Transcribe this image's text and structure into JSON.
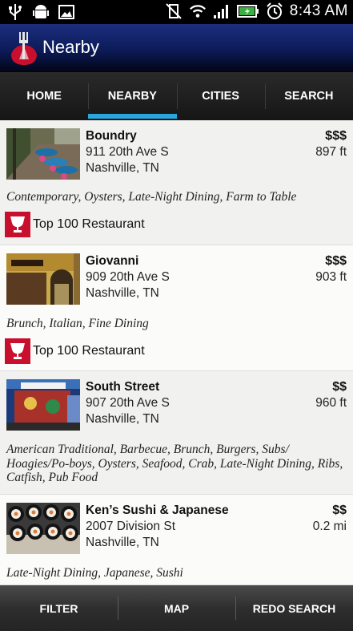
{
  "status_bar": {
    "left_icons": [
      "usb-icon",
      "android-debug-icon",
      "image-notification-icon"
    ],
    "right_icons": [
      "vibrate-mute-icon",
      "wifi-icon",
      "signal-icon",
      "battery-icon",
      "alarm-icon"
    ],
    "time": "8:43 AM"
  },
  "action_bar": {
    "title": "Nearby",
    "logo_icon": "fork-logo-icon"
  },
  "tabs": [
    {
      "label": "HOME",
      "active": false
    },
    {
      "label": "NEARBY",
      "active": true
    },
    {
      "label": "CITIES",
      "active": false
    },
    {
      "label": "SEARCH",
      "active": false
    }
  ],
  "restaurants": [
    {
      "name": "Boundry",
      "address": "911 20th Ave S",
      "city": "Nashville, TN",
      "price": "$$$",
      "distance": "897 ft",
      "tags": "Contemporary, Oysters, Late-Night Dining, Farm to Table",
      "award": "Top 100 Restaurant",
      "thumb": "patio-photo"
    },
    {
      "name": "Giovanni",
      "address": "909 20th Ave S",
      "city": "Nashville, TN",
      "price": "$$$",
      "distance": "903 ft",
      "tags": "Brunch, Italian, Fine Dining",
      "award": "Top 100 Restaurant",
      "thumb": "storefront-photo"
    },
    {
      "name": "South Street",
      "address": "907 20th Ave S",
      "city": "Nashville, TN",
      "price": "$$",
      "distance": "960 ft",
      "tags": "American Traditional, Barbecue, Brunch, Burgers, Subs/ Hoagies/Po-boys, Oysters, Seafood, Crab, Late-Night Dining, Ribs, Catfish, Pub Food",
      "award": null,
      "thumb": "mural-photo"
    },
    {
      "name": "Ken’s Sushi & Japanese",
      "address": "2007 Division St",
      "city": "Nashville, TN",
      "price": "$$",
      "distance": "0.2 mi",
      "tags": "Late-Night Dining, Japanese, Sushi",
      "award": null,
      "thumb": "sushi-photo"
    }
  ],
  "bottom_bar": [
    {
      "label": "FILTER"
    },
    {
      "label": "MAP"
    },
    {
      "label": "REDO SEARCH"
    }
  ],
  "colors": {
    "action_bar": "#0c1a57",
    "tab_indicator": "#2aa6dc",
    "award_red": "#c8102e"
  }
}
